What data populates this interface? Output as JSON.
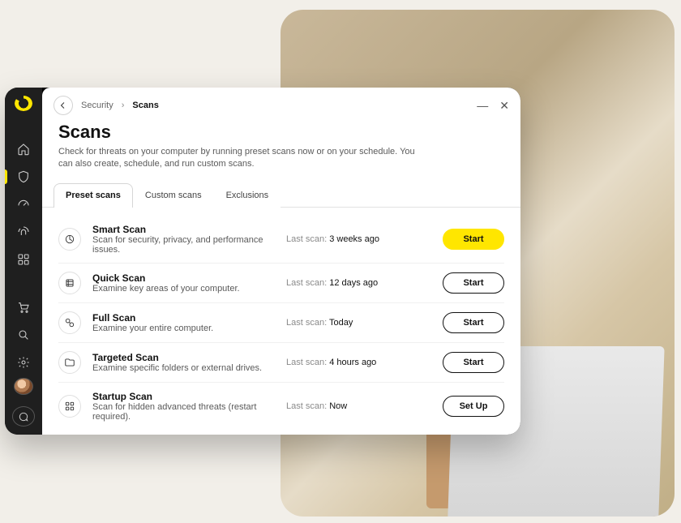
{
  "breadcrumb": {
    "parent": "Security",
    "current": "Scans"
  },
  "wincontrols": {
    "min": "—",
    "close": "✕"
  },
  "page": {
    "title": "Scans",
    "subtitle": "Check for threats on your computer by running preset scans now or on your schedule. You can also create, schedule, and run custom scans."
  },
  "tabs": [
    {
      "label": "Preset scans",
      "active": true
    },
    {
      "label": "Custom scans",
      "active": false
    },
    {
      "label": "Exclusions",
      "active": false
    }
  ],
  "meta_label": "Last scan: ",
  "scans": [
    {
      "name": "Smart Scan",
      "desc": "Scan for security, privacy, and performance issues.",
      "last": "3 weeks ago",
      "button": "Start",
      "primary": true
    },
    {
      "name": "Quick Scan",
      "desc": "Examine key areas of your computer.",
      "last": "12 days ago",
      "button": "Start",
      "primary": false
    },
    {
      "name": "Full Scan",
      "desc": "Examine your entire computer.",
      "last": "Today",
      "button": "Start",
      "primary": false
    },
    {
      "name": "Targeted Scan",
      "desc": "Examine specific folders or external drives.",
      "last": "4 hours ago",
      "button": "Start",
      "primary": false
    },
    {
      "name": "Startup Scan",
      "desc": "Scan for hidden advanced threats (restart required).",
      "last": "Now",
      "button": "Set Up",
      "primary": false
    }
  ]
}
